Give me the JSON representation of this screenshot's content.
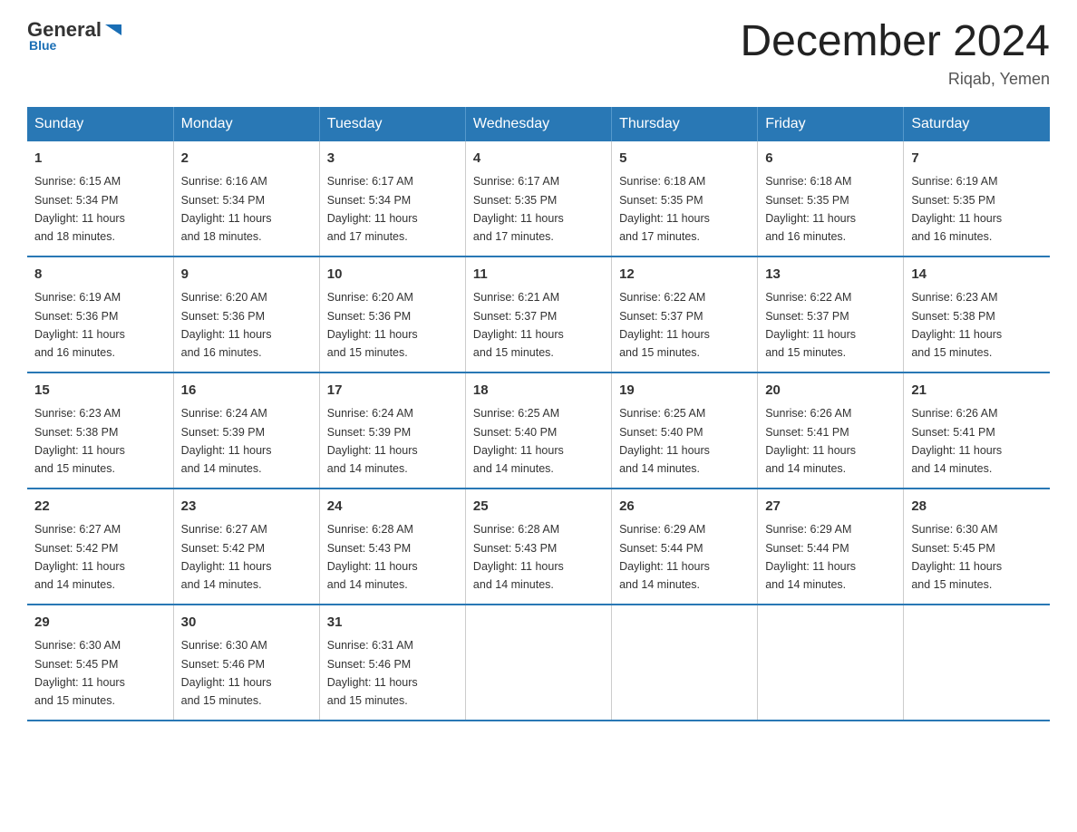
{
  "logo": {
    "general": "General",
    "blue": "Blue",
    "subtext": "Blue"
  },
  "title": "December 2024",
  "location": "Riqab, Yemen",
  "days_of_week": [
    "Sunday",
    "Monday",
    "Tuesday",
    "Wednesday",
    "Thursday",
    "Friday",
    "Saturday"
  ],
  "weeks": [
    [
      {
        "day": "1",
        "sunrise": "6:15 AM",
        "sunset": "5:34 PM",
        "daylight": "11 hours and 18 minutes."
      },
      {
        "day": "2",
        "sunrise": "6:16 AM",
        "sunset": "5:34 PM",
        "daylight": "11 hours and 18 minutes."
      },
      {
        "day": "3",
        "sunrise": "6:17 AM",
        "sunset": "5:34 PM",
        "daylight": "11 hours and 17 minutes."
      },
      {
        "day": "4",
        "sunrise": "6:17 AM",
        "sunset": "5:35 PM",
        "daylight": "11 hours and 17 minutes."
      },
      {
        "day": "5",
        "sunrise": "6:18 AM",
        "sunset": "5:35 PM",
        "daylight": "11 hours and 17 minutes."
      },
      {
        "day": "6",
        "sunrise": "6:18 AM",
        "sunset": "5:35 PM",
        "daylight": "11 hours and 16 minutes."
      },
      {
        "day": "7",
        "sunrise": "6:19 AM",
        "sunset": "5:35 PM",
        "daylight": "11 hours and 16 minutes."
      }
    ],
    [
      {
        "day": "8",
        "sunrise": "6:19 AM",
        "sunset": "5:36 PM",
        "daylight": "11 hours and 16 minutes."
      },
      {
        "day": "9",
        "sunrise": "6:20 AM",
        "sunset": "5:36 PM",
        "daylight": "11 hours and 16 minutes."
      },
      {
        "day": "10",
        "sunrise": "6:20 AM",
        "sunset": "5:36 PM",
        "daylight": "11 hours and 15 minutes."
      },
      {
        "day": "11",
        "sunrise": "6:21 AM",
        "sunset": "5:37 PM",
        "daylight": "11 hours and 15 minutes."
      },
      {
        "day": "12",
        "sunrise": "6:22 AM",
        "sunset": "5:37 PM",
        "daylight": "11 hours and 15 minutes."
      },
      {
        "day": "13",
        "sunrise": "6:22 AM",
        "sunset": "5:37 PM",
        "daylight": "11 hours and 15 minutes."
      },
      {
        "day": "14",
        "sunrise": "6:23 AM",
        "sunset": "5:38 PM",
        "daylight": "11 hours and 15 minutes."
      }
    ],
    [
      {
        "day": "15",
        "sunrise": "6:23 AM",
        "sunset": "5:38 PM",
        "daylight": "11 hours and 15 minutes."
      },
      {
        "day": "16",
        "sunrise": "6:24 AM",
        "sunset": "5:39 PM",
        "daylight": "11 hours and 14 minutes."
      },
      {
        "day": "17",
        "sunrise": "6:24 AM",
        "sunset": "5:39 PM",
        "daylight": "11 hours and 14 minutes."
      },
      {
        "day": "18",
        "sunrise": "6:25 AM",
        "sunset": "5:40 PM",
        "daylight": "11 hours and 14 minutes."
      },
      {
        "day": "19",
        "sunrise": "6:25 AM",
        "sunset": "5:40 PM",
        "daylight": "11 hours and 14 minutes."
      },
      {
        "day": "20",
        "sunrise": "6:26 AM",
        "sunset": "5:41 PM",
        "daylight": "11 hours and 14 minutes."
      },
      {
        "day": "21",
        "sunrise": "6:26 AM",
        "sunset": "5:41 PM",
        "daylight": "11 hours and 14 minutes."
      }
    ],
    [
      {
        "day": "22",
        "sunrise": "6:27 AM",
        "sunset": "5:42 PM",
        "daylight": "11 hours and 14 minutes."
      },
      {
        "day": "23",
        "sunrise": "6:27 AM",
        "sunset": "5:42 PM",
        "daylight": "11 hours and 14 minutes."
      },
      {
        "day": "24",
        "sunrise": "6:28 AM",
        "sunset": "5:43 PM",
        "daylight": "11 hours and 14 minutes."
      },
      {
        "day": "25",
        "sunrise": "6:28 AM",
        "sunset": "5:43 PM",
        "daylight": "11 hours and 14 minutes."
      },
      {
        "day": "26",
        "sunrise": "6:29 AM",
        "sunset": "5:44 PM",
        "daylight": "11 hours and 14 minutes."
      },
      {
        "day": "27",
        "sunrise": "6:29 AM",
        "sunset": "5:44 PM",
        "daylight": "11 hours and 14 minutes."
      },
      {
        "day": "28",
        "sunrise": "6:30 AM",
        "sunset": "5:45 PM",
        "daylight": "11 hours and 15 minutes."
      }
    ],
    [
      {
        "day": "29",
        "sunrise": "6:30 AM",
        "sunset": "5:45 PM",
        "daylight": "11 hours and 15 minutes."
      },
      {
        "day": "30",
        "sunrise": "6:30 AM",
        "sunset": "5:46 PM",
        "daylight": "11 hours and 15 minutes."
      },
      {
        "day": "31",
        "sunrise": "6:31 AM",
        "sunset": "5:46 PM",
        "daylight": "11 hours and 15 minutes."
      },
      {
        "day": "",
        "sunrise": "",
        "sunset": "",
        "daylight": ""
      },
      {
        "day": "",
        "sunrise": "",
        "sunset": "",
        "daylight": ""
      },
      {
        "day": "",
        "sunrise": "",
        "sunset": "",
        "daylight": ""
      },
      {
        "day": "",
        "sunrise": "",
        "sunset": "",
        "daylight": ""
      }
    ]
  ],
  "sunrise_label": "Sunrise:",
  "sunset_label": "Sunset:",
  "daylight_label": "Daylight:"
}
